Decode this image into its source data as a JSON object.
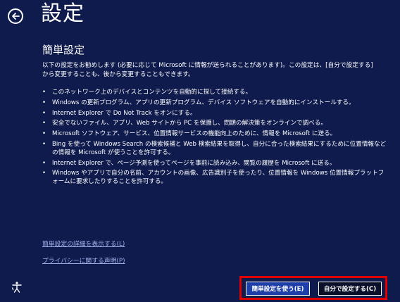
{
  "header": {
    "title": "設定",
    "back_icon": "back-arrow-icon"
  },
  "section": {
    "subtitle": "簡単設定",
    "intro": "以下の設定をお勧めします (必要に応じて Microsoft に情報が送られることがあります)。この設定は、[自分で設定する] から変更することも、後から変更することもできます。"
  },
  "bullets": [
    "このネットワーク上のデバイスとコンテンツを自動的に探して接続する。",
    "Windows の更新プログラム、アプリの更新プログラム、デバイス ソフトウェアを自動的にインストールする。",
    "Internet Explorer で Do Not Track をオンにする。",
    "安全でないファイル、アプリ、Web サイトから PC を保護し、問題の解決策をオンラインで調べる。",
    "Microsoft ソフトウェア、サービス、位置情報サービスの機能向上のために、情報を Microsoft に送る。",
    "Bing を使って Windows Search の検索候補と Web 検索結果を取得し、自分に合った検索結果にするために位置情報などの情報を Microsoft が使うことを許可する。",
    "Internet Explorer で、ページ予測を使ってページを事前に読み込み、閲覧の履歴を Microsoft に送る。",
    "Windows やアプリで自分の名前、アカウントの画像、広告識別子を使ったり、位置情報を Windows 位置情報プラットフォームに要求したりすることを許可する。"
  ],
  "links": {
    "details": "簡単設定の詳細を表示する(L)",
    "privacy": "プライバシーに関する声明(P)"
  },
  "buttons": {
    "express": "簡単設定を使う(E)",
    "customize": "自分で設定する(C)"
  },
  "colors": {
    "background": "#0f1b4d",
    "primary_button": "#1e3fa8",
    "highlight": "#e00000"
  },
  "accessibility_icon": "ease-of-access-icon"
}
